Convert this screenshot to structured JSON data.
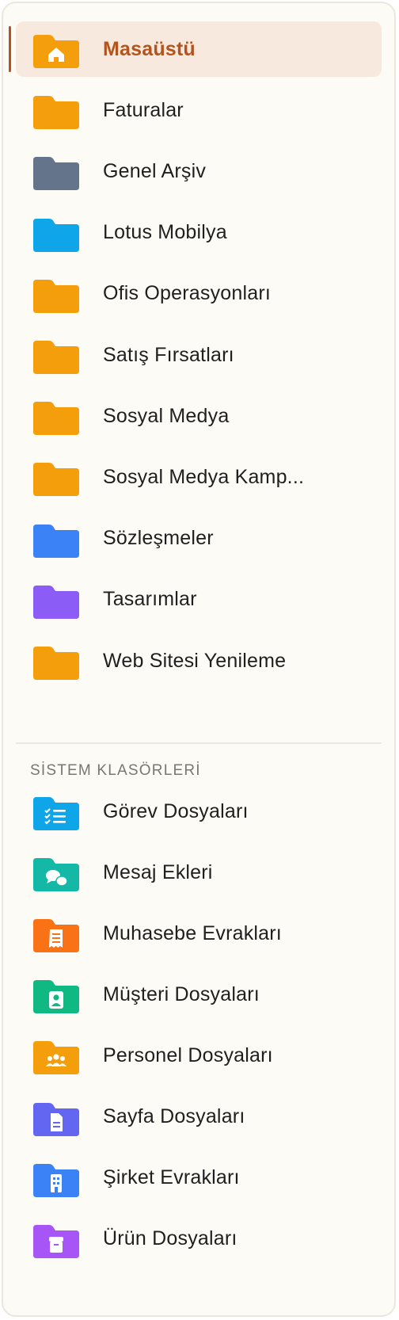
{
  "folders": [
    {
      "label": "Masaüstü",
      "color": "#f59e0b",
      "icon": "home-icon",
      "active": true
    },
    {
      "label": "Faturalar",
      "color": "#f59e0b",
      "icon": "folder-icon"
    },
    {
      "label": "Genel Arşiv",
      "color": "#64748b",
      "icon": "folder-icon"
    },
    {
      "label": "Lotus Mobilya",
      "color": "#0ea5e9",
      "icon": "folder-icon"
    },
    {
      "label": "Ofis Operasyonları",
      "color": "#f59e0b",
      "icon": "folder-icon"
    },
    {
      "label": "Satış Fırsatları",
      "color": "#f59e0b",
      "icon": "folder-icon"
    },
    {
      "label": "Sosyal Medya",
      "color": "#f59e0b",
      "icon": "folder-icon"
    },
    {
      "label": "Sosyal Medya Kamp...",
      "color": "#f59e0b",
      "icon": "folder-icon"
    },
    {
      "label": "Sözleşmeler",
      "color": "#3b82f6",
      "icon": "folder-icon"
    },
    {
      "label": "Tasarımlar",
      "color": "#8b5cf6",
      "icon": "folder-icon"
    },
    {
      "label": "Web Sitesi Yenileme",
      "color": "#f59e0b",
      "icon": "folder-icon"
    }
  ],
  "system_section": {
    "title": "SİSTEM KLASÖRLERİ",
    "items": [
      {
        "label": "Görev Dosyaları",
        "color": "#0ea5e9",
        "icon": "checklist-icon"
      },
      {
        "label": "Mesaj Ekleri",
        "color": "#14b8a6",
        "icon": "chat-icon"
      },
      {
        "label": "Muhasebe Evrakları",
        "color": "#f97316",
        "icon": "receipt-icon"
      },
      {
        "label": "Müşteri Dosyaları",
        "color": "#10b981",
        "icon": "person-icon"
      },
      {
        "label": "Personel Dosyaları",
        "color": "#f59e0b",
        "icon": "group-icon"
      },
      {
        "label": "Sayfa Dosyaları",
        "color": "#6366f1",
        "icon": "document-icon"
      },
      {
        "label": "Şirket Evrakları",
        "color": "#3b82f6",
        "icon": "building-icon"
      },
      {
        "label": "Ürün Dosyaları",
        "color": "#a855f7",
        "icon": "box-icon"
      }
    ]
  }
}
